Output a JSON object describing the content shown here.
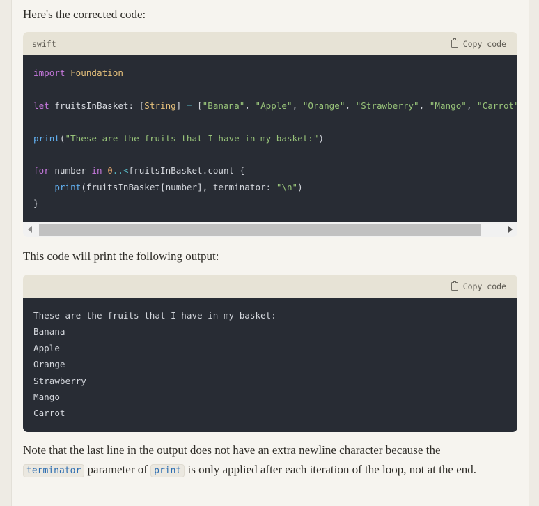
{
  "intro_text": "Here's the corrected code:",
  "code1": {
    "language": "swift",
    "copy_label": "Copy code",
    "lines": [
      {
        "tokens": [
          {
            "c": "kw",
            "t": "import"
          },
          {
            "c": "",
            "t": " "
          },
          {
            "c": "ty",
            "t": "Foundation"
          }
        ]
      },
      {
        "tokens": []
      },
      {
        "tokens": [
          {
            "c": "kw",
            "t": "let"
          },
          {
            "c": "",
            "t": " fruitsInBasket: ["
          },
          {
            "c": "ty",
            "t": "String"
          },
          {
            "c": "",
            "t": "] "
          },
          {
            "c": "op",
            "t": "="
          },
          {
            "c": "",
            "t": " ["
          },
          {
            "c": "st",
            "t": "\"Banana\""
          },
          {
            "c": "",
            "t": ", "
          },
          {
            "c": "st",
            "t": "\"Apple\""
          },
          {
            "c": "",
            "t": ", "
          },
          {
            "c": "st",
            "t": "\"Orange\""
          },
          {
            "c": "",
            "t": ", "
          },
          {
            "c": "st",
            "t": "\"Strawberry\""
          },
          {
            "c": "",
            "t": ", "
          },
          {
            "c": "st",
            "t": "\"Mango\""
          },
          {
            "c": "",
            "t": ", "
          },
          {
            "c": "st",
            "t": "\"Carrot\""
          },
          {
            "c": "",
            "t": "]"
          }
        ]
      },
      {
        "tokens": []
      },
      {
        "tokens": [
          {
            "c": "fn",
            "t": "print"
          },
          {
            "c": "",
            "t": "("
          },
          {
            "c": "st",
            "t": "\"These are the fruits that I have in my basket:\""
          },
          {
            "c": "",
            "t": ")"
          }
        ]
      },
      {
        "tokens": []
      },
      {
        "tokens": [
          {
            "c": "kw",
            "t": "for"
          },
          {
            "c": "",
            "t": " number "
          },
          {
            "c": "kw",
            "t": "in"
          },
          {
            "c": "",
            "t": " "
          },
          {
            "c": "nu",
            "t": "0"
          },
          {
            "c": "op",
            "t": "..<"
          },
          {
            "c": "",
            "t": "fruitsInBasket.count {"
          }
        ]
      },
      {
        "tokens": [
          {
            "c": "",
            "t": "    "
          },
          {
            "c": "fn",
            "t": "print"
          },
          {
            "c": "",
            "t": "(fruitsInBasket[number], terminator: "
          },
          {
            "c": "st",
            "t": "\"\\n\""
          },
          {
            "c": "",
            "t": ")"
          }
        ]
      },
      {
        "tokens": [
          {
            "c": "",
            "t": "}"
          }
        ]
      }
    ]
  },
  "output_intro": "This code will print the following output:",
  "code2": {
    "language": "",
    "copy_label": "Copy code",
    "lines": [
      "These are the fruits that I have in my basket:",
      "Banana",
      "Apple",
      "Orange",
      "Strawberry",
      "Mango",
      "Carrot"
    ]
  },
  "note": {
    "before": "Note that the last line in the output does not have an extra newline character because the ",
    "code_a": "terminator",
    "middle": " parameter of ",
    "code_b": "print",
    "after": " is only applied after each iteration of the loop, not at the end."
  }
}
